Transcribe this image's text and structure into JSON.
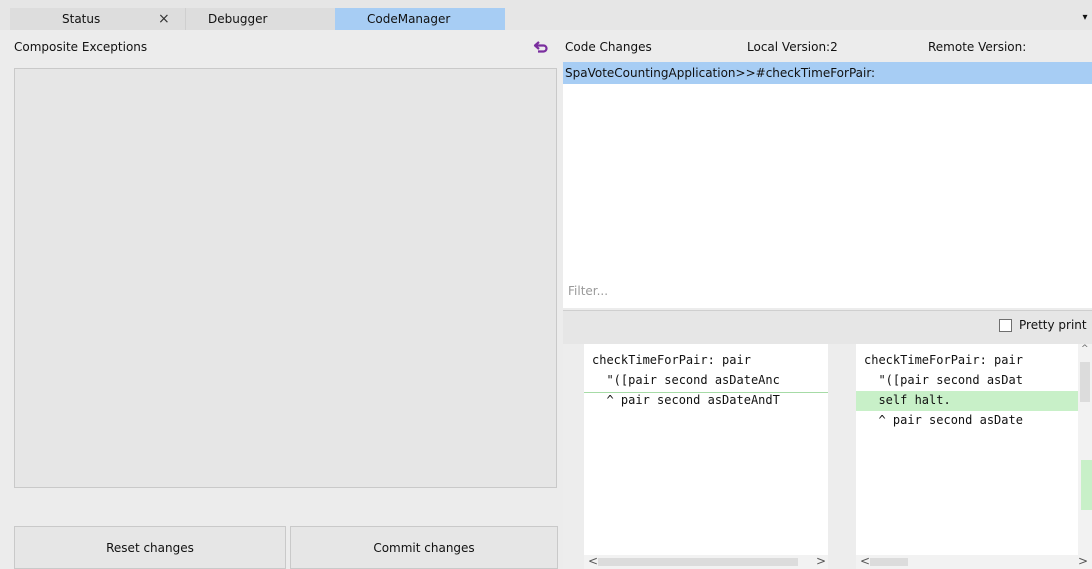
{
  "tabs": [
    {
      "label": "Status",
      "close": "×"
    },
    {
      "label": "Debugger"
    },
    {
      "label": "CodeManager"
    }
  ],
  "menu_glyph": "▾",
  "left": {
    "title": "Composite Exceptions",
    "reset_label": "Reset changes",
    "commit_label": "Commit changes"
  },
  "right": {
    "header_code_changes": "Code Changes",
    "header_local": "Local Version:2",
    "header_remote": "Remote Version:",
    "changes": [
      "SpaVoteCountingApplication>>#checkTimeForPair:"
    ],
    "filter_placeholder": "Filter...",
    "pretty_print_label": "Pretty print",
    "pretty_print_checked": false
  },
  "diff": {
    "left_lines": [
      "checkTimeForPair: pair",
      "  \"([pair second asDateAnc",
      "  ^ pair second asDateAndT"
    ],
    "right_lines": [
      "checkTimeForPair: pair",
      "  \"([pair second asDat",
      "  self halt.",
      "  ^ pair second asDate"
    ]
  },
  "colors": {
    "selected": "#a7cdf4",
    "added": "#c8f0c8",
    "panel": "#e6e6e6"
  },
  "icons": {
    "undo": "undo-arrow-icon",
    "menu": "chevron-down-icon"
  }
}
